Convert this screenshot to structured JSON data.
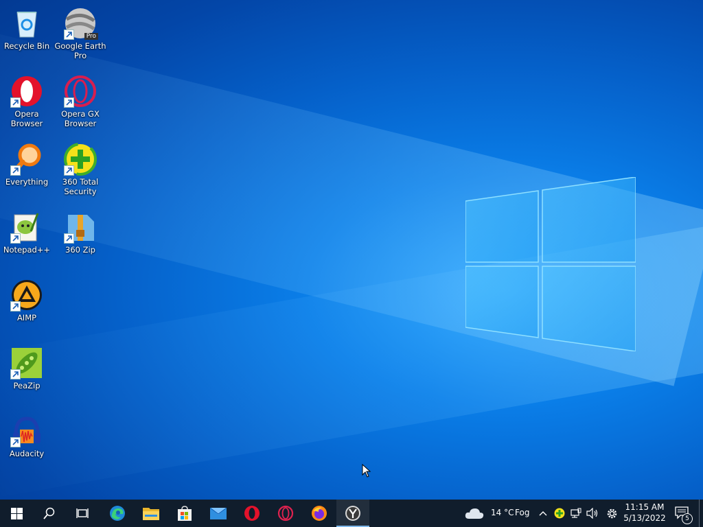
{
  "desktop": {
    "icons": [
      {
        "label": "Recycle Bin"
      },
      {
        "label": "Google Earth Pro"
      },
      {
        "label": "Opera Browser"
      },
      {
        "label": "Opera GX Browser"
      },
      {
        "label": "Everything"
      },
      {
        "label": "360 Total Security"
      },
      {
        "label": "Notepad++"
      },
      {
        "label": "360 Zip"
      },
      {
        "label": "AIMP"
      },
      {
        "label": "PeaZip"
      },
      {
        "label": "Audacity"
      }
    ],
    "google_earth_badge": "Pro"
  },
  "taskbar": {
    "pinned": [
      {
        "icon": "start-windows-icon"
      },
      {
        "icon": "search-icon"
      },
      {
        "icon": "task-view-icon"
      },
      {
        "icon": "edge-icon"
      },
      {
        "icon": "file-explorer-icon"
      },
      {
        "icon": "microsoft-store-icon"
      },
      {
        "icon": "mail-icon"
      },
      {
        "icon": "opera-icon"
      },
      {
        "icon": "opera-gx-icon"
      },
      {
        "icon": "firefox-icon"
      },
      {
        "icon": "yandex-browser-icon",
        "active": true
      }
    ],
    "weather": {
      "temp": "14 °C",
      "condition": "Fog"
    },
    "clock": {
      "time": "11:15 AM",
      "date": "5/13/2022"
    },
    "notifications_count": "5"
  },
  "colors": {
    "taskbar_bg": "#101d2c",
    "desktop_accent": "#0a7ee8"
  }
}
